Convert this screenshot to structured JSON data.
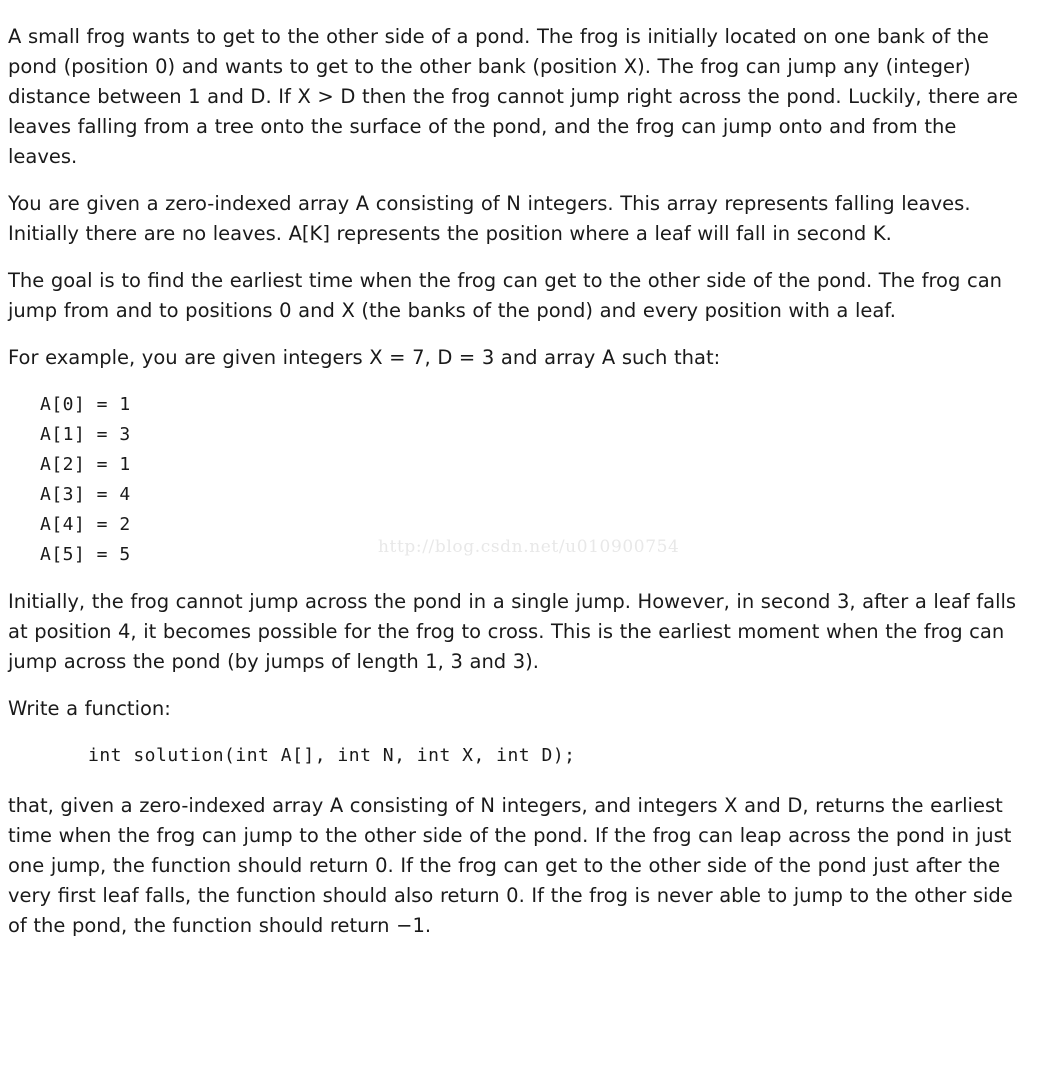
{
  "document": {
    "background_color": "#ffffff",
    "text_color": "#1a1a1a",
    "watermark_color": "#e8e8e8"
  },
  "paragraphs": {
    "intro": "A small frog wants to get to the other side of a pond. The frog is initially located on one bank of the pond (position 0) and wants to get to the other bank (position X). The frog can jump any (integer) distance between 1 and D. If X > D then the frog cannot jump right across the pond. Luckily, there are leaves falling from a tree onto the surface of the pond, and the frog can jump onto and from the leaves.",
    "array_description": "You are given a zero-indexed array A consisting of N integers. This array represents falling leaves. Initially there are no leaves. A[K] represents the position where a leaf will fall in second K.",
    "goal": "The goal is to find the earliest time when the frog can get to the other side of the pond. The frog can jump from and to positions 0 and X (the banks of the pond) and every position with a leaf.",
    "example_intro": "For example, you are given integers X = 7, D = 3 and array A such that:",
    "example_explanation": "Initially, the frog cannot jump across the pond in a single jump. However, in second 3, after a leaf falls at position 4, it becomes possible for the frog to cross. This is the earliest moment when the frog can jump across the pond (by jumps of length 1, 3 and 3).",
    "write_function": "Write a function:",
    "returns_description": "that, given a zero-indexed array A consisting of N integers, and integers X and D, returns the earliest time when the frog can jump to the other side of the pond. If the frog can leap across the pond in just one jump, the function should return 0. If the frog can get to the other side of the pond just after the very first leaf falls, the function should also return 0. If the frog is never able to jump to the other side of the pond, the function should return −1."
  },
  "example": {
    "X": 7,
    "D": 3,
    "array_lines": "A[0] = 1\nA[1] = 3\nA[2] = 1\nA[3] = 4\nA[4] = 2\nA[5] = 5",
    "array_entries": [
      {
        "index": "A[0]",
        "operator": "=",
        "value": "1"
      },
      {
        "index": "A[1]",
        "operator": "=",
        "value": "3"
      },
      {
        "index": "A[2]",
        "operator": "=",
        "value": "1"
      },
      {
        "index": "A[3]",
        "operator": "=",
        "value": "4"
      },
      {
        "index": "A[4]",
        "operator": "=",
        "value": "2"
      },
      {
        "index": "A[5]",
        "operator": "=",
        "value": "5"
      }
    ]
  },
  "signature": {
    "code": "int solution(int A[], int N, int X, int D);"
  },
  "watermark": {
    "text": "http://blog.csdn.net/u010900754"
  }
}
